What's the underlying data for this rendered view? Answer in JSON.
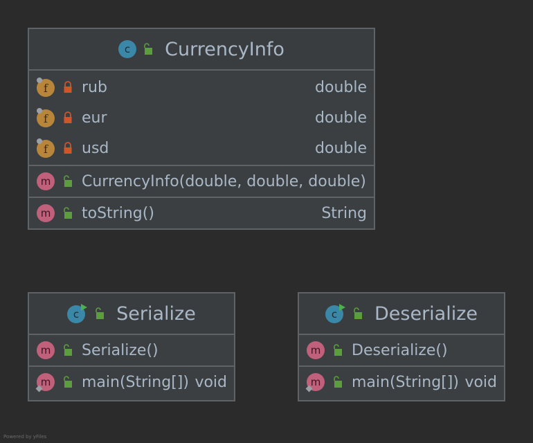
{
  "colors": {
    "background": "#2b2b2b",
    "box_fill": "#3b3f42",
    "box_border": "#606366",
    "text": "#a9b7c6",
    "class_icon": "#3a87a8",
    "field_icon": "#b8863b",
    "method_icon": "#c0607a",
    "private_lock": "#d0542c",
    "public_lock": "#5c9e3e",
    "run_marker": "#4caf50"
  },
  "classes": [
    {
      "name": "CurrencyInfo",
      "icon": "class-icon",
      "visibility": "public",
      "fields": [
        {
          "name": "rub",
          "type": "double",
          "icon": "field-icon",
          "visibility": "private"
        },
        {
          "name": "eur",
          "type": "double",
          "icon": "field-icon",
          "visibility": "private"
        },
        {
          "name": "usd",
          "type": "double",
          "icon": "field-icon",
          "visibility": "private"
        }
      ],
      "constructors": [
        {
          "name": "CurrencyInfo(double, double, double)",
          "type": "",
          "icon": "method-icon",
          "visibility": "public"
        }
      ],
      "methods": [
        {
          "name": "toString()",
          "type": "String",
          "icon": "method-icon",
          "visibility": "public"
        }
      ]
    },
    {
      "name": "Serialize",
      "icon": "runnable-class-icon",
      "visibility": "public",
      "constructors": [
        {
          "name": "Serialize()",
          "type": "",
          "icon": "method-icon",
          "visibility": "public"
        }
      ],
      "methods": [
        {
          "name": "main(String[])",
          "type": "void",
          "icon": "static-method-icon",
          "visibility": "public"
        }
      ]
    },
    {
      "name": "Deserialize",
      "icon": "runnable-class-icon",
      "visibility": "public",
      "constructors": [
        {
          "name": "Deserialize()",
          "type": "",
          "icon": "method-icon",
          "visibility": "public"
        }
      ],
      "methods": [
        {
          "name": "main(String[])",
          "type": "void",
          "icon": "static-method-icon",
          "visibility": "public"
        }
      ]
    }
  ],
  "footer": {
    "text": "Powered by yFiles"
  }
}
